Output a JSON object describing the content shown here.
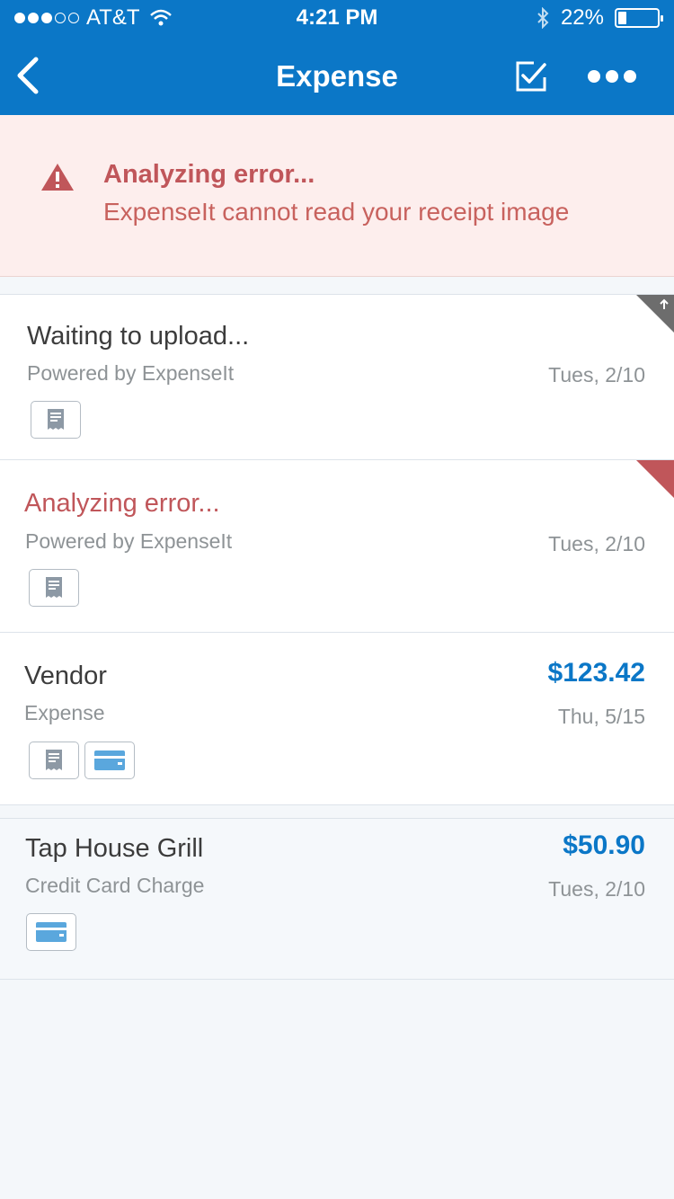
{
  "status_bar": {
    "carrier": "AT&T",
    "time": "4:21 PM",
    "battery": "22%",
    "battery_level": 0.22
  },
  "nav": {
    "title": "Expense"
  },
  "banner": {
    "title": "Analyzing error...",
    "message": "ExpenseIt cannot read your receipt image"
  },
  "items": [
    {
      "title": "Waiting to upload...",
      "subtitle": "Powered by ExpenseIt",
      "date": "Tues, 2/10",
      "amount": "",
      "attachments": [
        "receipt-icon"
      ],
      "corner": "upload-flag-icon"
    },
    {
      "title": "Analyzing error...",
      "subtitle": "Powered by ExpenseIt",
      "date": "Tues, 2/10",
      "amount": "",
      "attachments": [
        "receipt-icon"
      ],
      "corner": "error-flag-icon"
    },
    {
      "title": "Vendor",
      "subtitle": "Expense",
      "date": "Thu, 5/15",
      "amount": "$123.42",
      "attachments": [
        "receipt-icon",
        "credit-card-icon"
      ]
    },
    {
      "title": "Tap House Grill",
      "subtitle": "Credit Card Charge",
      "date": "Tues, 2/10",
      "amount": "$50.90",
      "attachments": [
        "credit-card-icon"
      ]
    }
  ],
  "colors": {
    "brand": "#0b77c7",
    "error": "#c0565a",
    "error_bg": "#fdeeed"
  }
}
